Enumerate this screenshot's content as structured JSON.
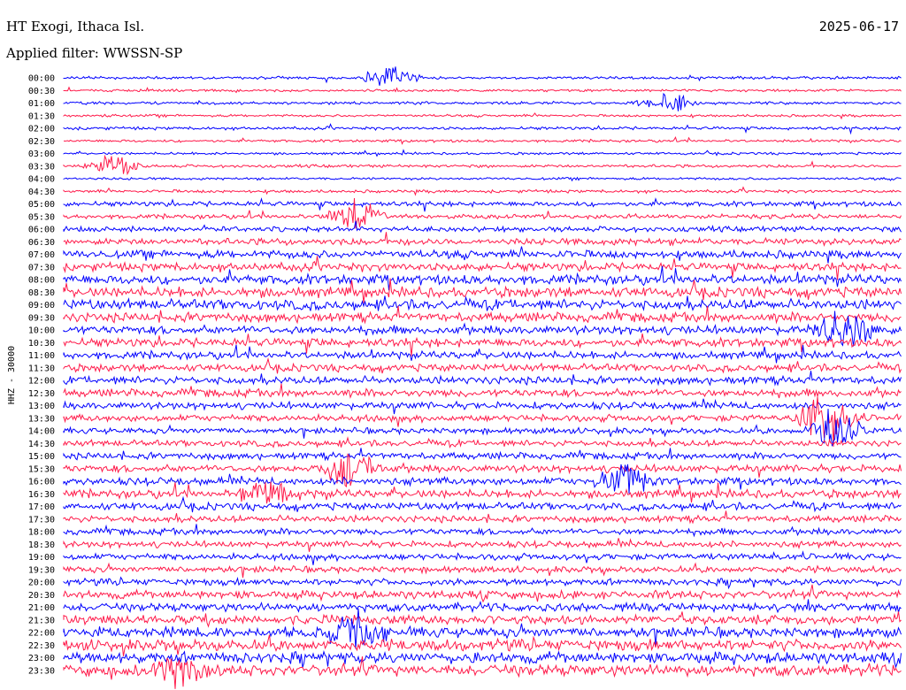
{
  "header": {
    "station": "HT Exogi, Ithaca Isl.",
    "date": "2025-06-17",
    "filter": "Applied filter: WWSSN-SP"
  },
  "chart_data": {
    "type": "line",
    "title": "HT Exogi, Ithaca Isl.",
    "subtitle": "Applied filter: WWSSN-SP",
    "date": "2025-06-17",
    "ylabel": "HHZ - 30000",
    "colors": [
      "#0000ff",
      "#ff1a4a"
    ],
    "rows": [
      {
        "label": "00:00",
        "amp": 1.5
      },
      {
        "label": "00:30",
        "amp": 1.3
      },
      {
        "label": "01:00",
        "amp": 1.5
      },
      {
        "label": "01:30",
        "amp": 1.3
      },
      {
        "label": "02:00",
        "amp": 1.6
      },
      {
        "label": "02:30",
        "amp": 1.4
      },
      {
        "label": "03:00",
        "amp": 1.3
      },
      {
        "label": "03:30",
        "amp": 1.6
      },
      {
        "label": "04:00",
        "amp": 1.3
      },
      {
        "label": "04:30",
        "amp": 1.6
      },
      {
        "label": "05:00",
        "amp": 2.6
      },
      {
        "label": "05:30",
        "amp": 2.4
      },
      {
        "label": "06:00",
        "amp": 2.8
      },
      {
        "label": "06:30",
        "amp": 3.6
      },
      {
        "label": "07:00",
        "amp": 4.2
      },
      {
        "label": "07:30",
        "amp": 4.4
      },
      {
        "label": "08:00",
        "amp": 5.2
      },
      {
        "label": "08:30",
        "amp": 5.5
      },
      {
        "label": "09:00",
        "amp": 5.5
      },
      {
        "label": "09:30",
        "amp": 5.0
      },
      {
        "label": "10:00",
        "amp": 4.6
      },
      {
        "label": "10:30",
        "amp": 4.6
      },
      {
        "label": "11:00",
        "amp": 4.0
      },
      {
        "label": "11:30",
        "amp": 4.0
      },
      {
        "label": "12:00",
        "amp": 4.2
      },
      {
        "label": "12:30",
        "amp": 4.2
      },
      {
        "label": "13:00",
        "amp": 3.8
      },
      {
        "label": "13:30",
        "amp": 3.6
      },
      {
        "label": "14:00",
        "amp": 3.2
      },
      {
        "label": "14:30",
        "amp": 3.4
      },
      {
        "label": "15:00",
        "amp": 3.6
      },
      {
        "label": "15:30",
        "amp": 4.0
      },
      {
        "label": "16:00",
        "amp": 4.0
      },
      {
        "label": "16:30",
        "amp": 4.4
      },
      {
        "label": "17:00",
        "amp": 4.0
      },
      {
        "label": "17:30",
        "amp": 3.6
      },
      {
        "label": "18:00",
        "amp": 3.4
      },
      {
        "label": "18:30",
        "amp": 3.4
      },
      {
        "label": "19:00",
        "amp": 3.4
      },
      {
        "label": "19:30",
        "amp": 3.4
      },
      {
        "label": "20:00",
        "amp": 3.6
      },
      {
        "label": "20:30",
        "amp": 4.4
      },
      {
        "label": "21:00",
        "amp": 4.4
      },
      {
        "label": "21:30",
        "amp": 5.0
      },
      {
        "label": "22:00",
        "amp": 5.5
      },
      {
        "label": "22:30",
        "amp": 6.0
      },
      {
        "label": "23:00",
        "amp": 6.0
      },
      {
        "label": "23:30",
        "amp": 6.0
      }
    ],
    "events": [
      {
        "time": "00:00",
        "pos": 0.39,
        "amp": 16
      },
      {
        "time": "01:00",
        "pos": 0.72,
        "amp": 14
      },
      {
        "time": "03:30",
        "pos": 0.06,
        "amp": 14
      },
      {
        "time": "05:30",
        "pos": 0.35,
        "amp": 22
      },
      {
        "time": "10:00",
        "pos": 0.93,
        "amp": 30
      },
      {
        "time": "13:30",
        "pos": 0.91,
        "amp": 40
      },
      {
        "time": "14:00",
        "pos": 0.92,
        "amp": 30
      },
      {
        "time": "15:30",
        "pos": 0.34,
        "amp": 22
      },
      {
        "time": "16:00",
        "pos": 0.67,
        "amp": 22
      },
      {
        "time": "16:30",
        "pos": 0.24,
        "amp": 18
      },
      {
        "time": "22:00",
        "pos": 0.35,
        "amp": 26
      },
      {
        "time": "23:30",
        "pos": 0.14,
        "amp": 24
      }
    ]
  }
}
